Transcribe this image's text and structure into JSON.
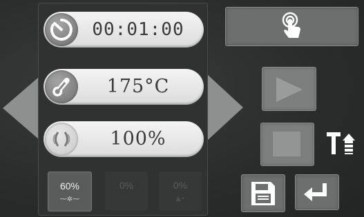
{
  "timer": {
    "value": "00:01:00",
    "icon": "timer-icon"
  },
  "temperature": {
    "value": "175°C",
    "icon": "thermometer-icon"
  },
  "power": {
    "value": "100%",
    "icon": "sound-wave-icon"
  },
  "presets": [
    {
      "value": "60%",
      "icon": "fan-icon",
      "active": true
    },
    {
      "value": "0%",
      "icon": "fan-icon",
      "active": false
    },
    {
      "value": "0%",
      "icon": "spray-icon",
      "active": false
    }
  ],
  "colors": {
    "pill": "#ececec",
    "button": "#6d6f6f",
    "icon_white": "#ffffff"
  }
}
